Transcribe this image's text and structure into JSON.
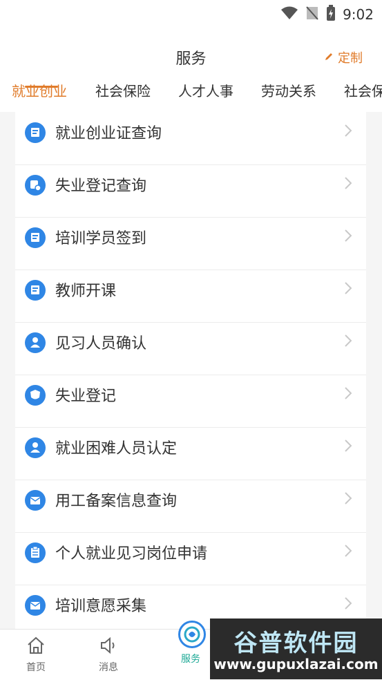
{
  "status": {
    "time": "9:02"
  },
  "header": {
    "title": "服务",
    "customize_label": "定制"
  },
  "tabs": [
    {
      "label": "就业创业"
    },
    {
      "label": "社会保险"
    },
    {
      "label": "人才人事"
    },
    {
      "label": "劳动关系"
    },
    {
      "label": "社会保"
    }
  ],
  "list": [
    {
      "label": "就业创业证查询",
      "icon": "document-icon"
    },
    {
      "label": "失业登记查询",
      "icon": "unemployment-search-icon"
    },
    {
      "label": "培训学员签到",
      "icon": "document-icon"
    },
    {
      "label": "教师开课",
      "icon": "document-icon"
    },
    {
      "label": "见习人员确认",
      "icon": "user-icon"
    },
    {
      "label": "失业登记",
      "icon": "unemployment-shield-icon"
    },
    {
      "label": "就业困难人员认定",
      "icon": "user-icon"
    },
    {
      "label": "用工备案信息查询",
      "icon": "mail-icon"
    },
    {
      "label": "个人就业见习岗位申请",
      "icon": "clipboard-icon"
    },
    {
      "label": "培训意愿采集",
      "icon": "mail-icon"
    }
  ],
  "bottom_nav": [
    {
      "label": "首页",
      "icon": "home-icon"
    },
    {
      "label": "消息",
      "icon": "speaker-icon"
    },
    {
      "label": "服务",
      "icon": "service-icon"
    }
  ],
  "watermark": {
    "title": "谷普软件园",
    "url": "www.gupuxlazai.com"
  },
  "colors": {
    "accent": "#e07b2a",
    "icon_blue": "#2f86e5",
    "service_teal": "#1ea996"
  }
}
